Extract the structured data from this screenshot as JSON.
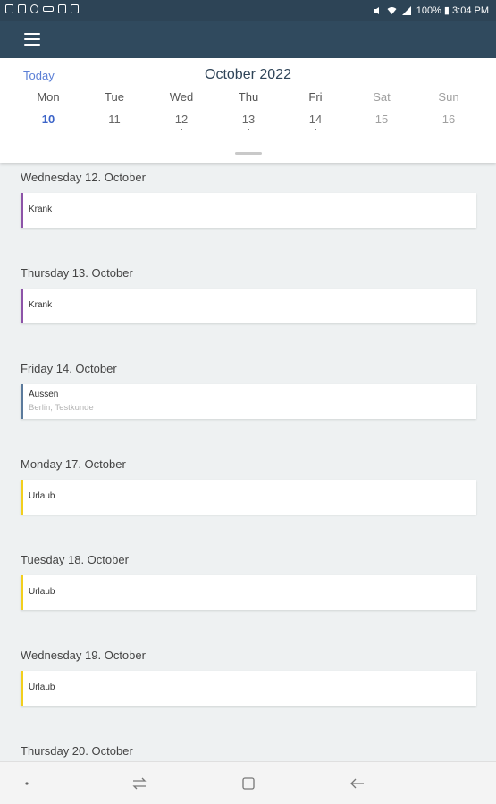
{
  "statusbar": {
    "text": "100% ▮ 3:04 PM"
  },
  "calendar": {
    "today_label": "Today",
    "month_title": "October 2022",
    "days": [
      {
        "name": "Mon",
        "date": "10"
      },
      {
        "name": "Tue",
        "date": "11"
      },
      {
        "name": "Wed",
        "date": "12"
      },
      {
        "name": "Thu",
        "date": "13"
      },
      {
        "name": "Fri",
        "date": "14"
      },
      {
        "name": "Sat",
        "date": "15"
      },
      {
        "name": "Sun",
        "date": "16"
      }
    ]
  },
  "agenda": [
    {
      "date_label": "Wednesday 12. October",
      "title": "Krank",
      "subtitle": "",
      "color": "#8d53a8"
    },
    {
      "date_label": "Thursday 13. October",
      "title": "Krank",
      "subtitle": "",
      "color": "#8d53a8"
    },
    {
      "date_label": "Friday 14. October",
      "title": "Aussen",
      "subtitle": "Berlin, Testkunde",
      "color": "#5b7a9c"
    },
    {
      "date_label": "Monday 17. October",
      "title": "Urlaub",
      "subtitle": "",
      "color": "#f2cf1d"
    },
    {
      "date_label": "Tuesday 18. October",
      "title": "Urlaub",
      "subtitle": "",
      "color": "#f2cf1d"
    },
    {
      "date_label": "Wednesday 19. October",
      "title": "Urlaub",
      "subtitle": "",
      "color": "#f2cf1d"
    },
    {
      "date_label": "Thursday 20. October"
    }
  ],
  "icons": {
    "menu": "menu-icon",
    "nav_dot": "nav-dot-icon",
    "recent_apps": "recent-apps-icon",
    "home": "home-icon",
    "back": "back-icon"
  }
}
